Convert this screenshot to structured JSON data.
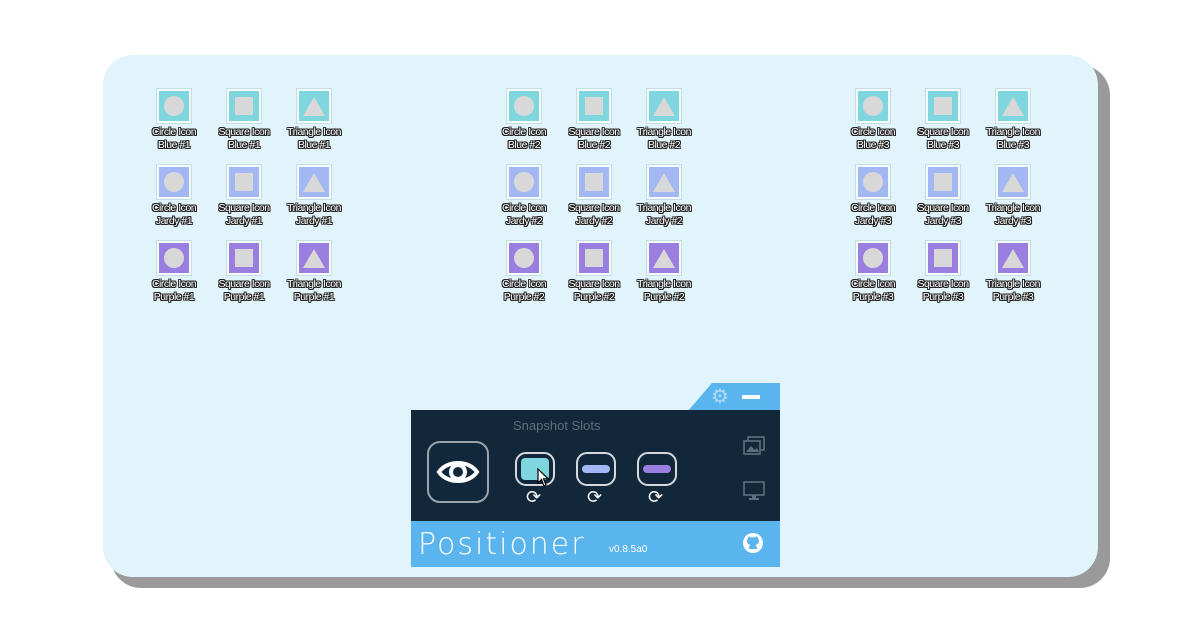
{
  "colors": {
    "blue": "#7fd6de",
    "jardy": "#a3b8f2",
    "purple": "#9b7fe0",
    "panel_bg": "#12273a",
    "accent": "#5ab4ed"
  },
  "desktop_groups": [
    {
      "rows": [
        [
          {
            "shape": "circle",
            "color": "blue",
            "label1": "Circle Icon",
            "label2": "Blue #1"
          },
          {
            "shape": "square",
            "color": "blue",
            "label1": "Square Icon",
            "label2": "Blue #1"
          },
          {
            "shape": "triangle",
            "color": "blue",
            "label1": "Triangle Icon",
            "label2": "Blue #1"
          }
        ],
        [
          {
            "shape": "circle",
            "color": "jardy",
            "label1": "Circle Icon",
            "label2": "Jardy #1"
          },
          {
            "shape": "square",
            "color": "jardy",
            "label1": "Square Icon",
            "label2": "Jardy #1"
          },
          {
            "shape": "triangle",
            "color": "jardy",
            "label1": "Triangle Icon",
            "label2": "Jardy #1"
          }
        ],
        [
          {
            "shape": "circle",
            "color": "purple",
            "label1": "Circle Icon",
            "label2": "Purple #1"
          },
          {
            "shape": "square",
            "color": "purple",
            "label1": "Square Icon",
            "label2": "Purple #1"
          },
          {
            "shape": "triangle",
            "color": "purple",
            "label1": "Triangle Icon",
            "label2": "Purple #1"
          }
        ]
      ]
    },
    {
      "rows": [
        [
          {
            "shape": "circle",
            "color": "blue",
            "label1": "Circle Icon",
            "label2": "Blue #2"
          },
          {
            "shape": "square",
            "color": "blue",
            "label1": "Square Icon",
            "label2": "Blue #2"
          },
          {
            "shape": "triangle",
            "color": "blue",
            "label1": "Triangle Icon",
            "label2": "Blue #2"
          }
        ],
        [
          {
            "shape": "circle",
            "color": "jardy",
            "label1": "Circle Icon",
            "label2": "Jardy #2"
          },
          {
            "shape": "square",
            "color": "jardy",
            "label1": "Square Icon",
            "label2": "Jardy #2"
          },
          {
            "shape": "triangle",
            "color": "jardy",
            "label1": "Triangle Icon",
            "label2": "Jardy #2"
          }
        ],
        [
          {
            "shape": "circle",
            "color": "purple",
            "label1": "Circle Icon",
            "label2": "Purple #2"
          },
          {
            "shape": "square",
            "color": "purple",
            "label1": "Square Icon",
            "label2": "Purple #2"
          },
          {
            "shape": "triangle",
            "color": "purple",
            "label1": "Triangle Icon",
            "label2": "Purple #2"
          }
        ]
      ]
    },
    {
      "rows": [
        [
          {
            "shape": "circle",
            "color": "blue",
            "label1": "Circle Icon",
            "label2": "Blue #3"
          },
          {
            "shape": "square",
            "color": "blue",
            "label1": "Square Icon",
            "label2": "Blue #3"
          },
          {
            "shape": "triangle",
            "color": "blue",
            "label1": "Triangle Icon",
            "label2": "Blue #3"
          }
        ],
        [
          {
            "shape": "circle",
            "color": "jardy",
            "label1": "Circle Icon",
            "label2": "Jardy #3"
          },
          {
            "shape": "square",
            "color": "jardy",
            "label1": "Square Icon",
            "label2": "Jardy #3"
          },
          {
            "shape": "triangle",
            "color": "jardy",
            "label1": "Triangle Icon",
            "label2": "Jardy #3"
          }
        ],
        [
          {
            "shape": "circle",
            "color": "purple",
            "label1": "Circle Icon",
            "label2": "Purple #3"
          },
          {
            "shape": "square",
            "color": "purple",
            "label1": "Square Icon",
            "label2": "Purple #3"
          },
          {
            "shape": "triangle",
            "color": "purple",
            "label1": "Triangle Icon",
            "label2": "Purple #3"
          }
        ]
      ]
    }
  ],
  "panel": {
    "title": "Snapshot Slots",
    "brand": "Positioner",
    "version": "v0.8.5a0",
    "header_icons": [
      "gear-icon",
      "minimize-icon"
    ],
    "main_button_icon": "eye-icon",
    "slots": [
      {
        "icon": "slot-blue",
        "color": "blue",
        "refresh_icon": "refresh-icon"
      },
      {
        "icon": "slot-jardy",
        "color": "jardy",
        "refresh_icon": "refresh-icon"
      },
      {
        "icon": "slot-purple",
        "color": "purple",
        "refresh_icon": "refresh-icon"
      }
    ],
    "side_icons": [
      "gallery-icon",
      "monitor-icon"
    ],
    "footer_icon": "github-icon"
  }
}
